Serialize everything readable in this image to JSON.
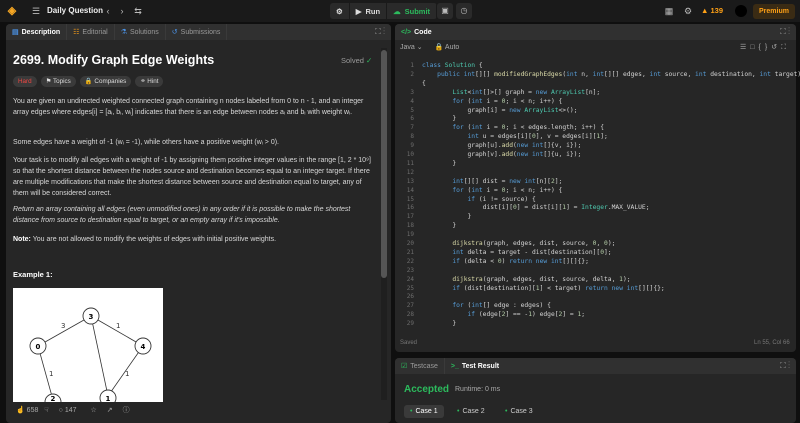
{
  "topbar": {
    "title": "Daily Question",
    "run_label": "Run",
    "submit_label": "Submit",
    "streak": "139",
    "premium_label": "Premium"
  },
  "left_tabs": {
    "description": "Description",
    "editorial": "Editorial",
    "solutions": "Solutions",
    "submissions": "Submissions"
  },
  "problem": {
    "title": "2699. Modify Graph Edge Weights",
    "status": "Solved",
    "difficulty": "Hard",
    "tag_topics": "Topics",
    "tag_companies": "Companies",
    "tag_hint": "Hint",
    "p1": "You are given an undirected weighted connected graph containing n nodes labeled from 0 to n - 1, and an integer array edges where edges[i] = [aᵢ, bᵢ, wᵢ] indicates that there is an edge between nodes aᵢ and bᵢ with weight wᵢ.",
    "p2": "Some edges have a weight of -1 (wᵢ = -1), while others have a positive weight (wᵢ > 0).",
    "p3": "Your task is to modify all edges with a weight of -1 by assigning them positive integer values in the range [1, 2 * 10⁹] so that the shortest distance between the nodes source and destination becomes equal to an integer target. If there are multiple modifications that make the shortest distance between source and destination equal to target, any of them will be considered correct.",
    "p4": "Return an array containing all edges (even unmodified ones) in any order if it is possible to make the shortest distance from source to destination equal to target, or an empty array if it's impossible.",
    "p5_label": "Note:",
    "p5": " You are not allowed to modify the weights of edges with initial positive weights.",
    "example_title": "Example 1:",
    "graph": {
      "nodes": [
        "0",
        "1",
        "2",
        "3",
        "4"
      ],
      "edge_labels": [
        "3",
        "1",
        "1",
        "1"
      ]
    }
  },
  "bottom": {
    "likes": "658",
    "comments": "147"
  },
  "code_panel": {
    "tab": "Code",
    "language": "Java",
    "mode": "Auto",
    "saved": "Saved",
    "position": "Ln 55, Col 66"
  },
  "code_lines": [
    "class Solution {",
    "    public int[][] modifiedGraphEdges(int n, int[][] edges, int source, int destination, int target)",
    "{",
    "        List<int[]>[] graph = new ArrayList[n];",
    "        for (int i = 0; i < n; i++) {",
    "            graph[i] = new ArrayList<>();",
    "        }",
    "        for (int i = 0; i < edges.length; i++) {",
    "            int u = edges[i][0], v = edges[i][1];",
    "            graph[u].add(new int[]{v, i});",
    "            graph[v].add(new int[]{u, i});",
    "        }",
    "",
    "        int[][] dist = new int[n][2];",
    "        for (int i = 0; i < n; i++) {",
    "            if (i != source) {",
    "                dist[i][0] = dist[i][1] = Integer.MAX_VALUE;",
    "            }",
    "        }",
    "",
    "        dijkstra(graph, edges, dist, source, 0, 0);",
    "        int delta = target - dist[destination][0];",
    "        if (delta < 0) return new int[][]{};",
    "",
    "        dijkstra(graph, edges, dist, source, delta, 1);",
    "        if (dist[destination][1] < target) return new int[][]{};",
    "",
    "        for (int[] edge : edges) {",
    "            if (edge[2] == -1) edge[2] = 1;",
    "        }"
  ],
  "line_numbers": [
    "1",
    "2",
    "",
    "3",
    "4",
    "5",
    "6",
    "7",
    "8",
    "9",
    "10",
    "11",
    "12",
    "13",
    "14",
    "15",
    "16",
    "17",
    "18",
    "19",
    "20",
    "21",
    "22",
    "23",
    "24",
    "25",
    "26",
    "27",
    "28",
    "29"
  ],
  "result": {
    "tab_testcase": "Testcase",
    "tab_result": "Test Result",
    "status": "Accepted",
    "runtime": "Runtime: 0 ms",
    "cases": [
      "Case 1",
      "Case 2",
      "Case 3"
    ]
  }
}
